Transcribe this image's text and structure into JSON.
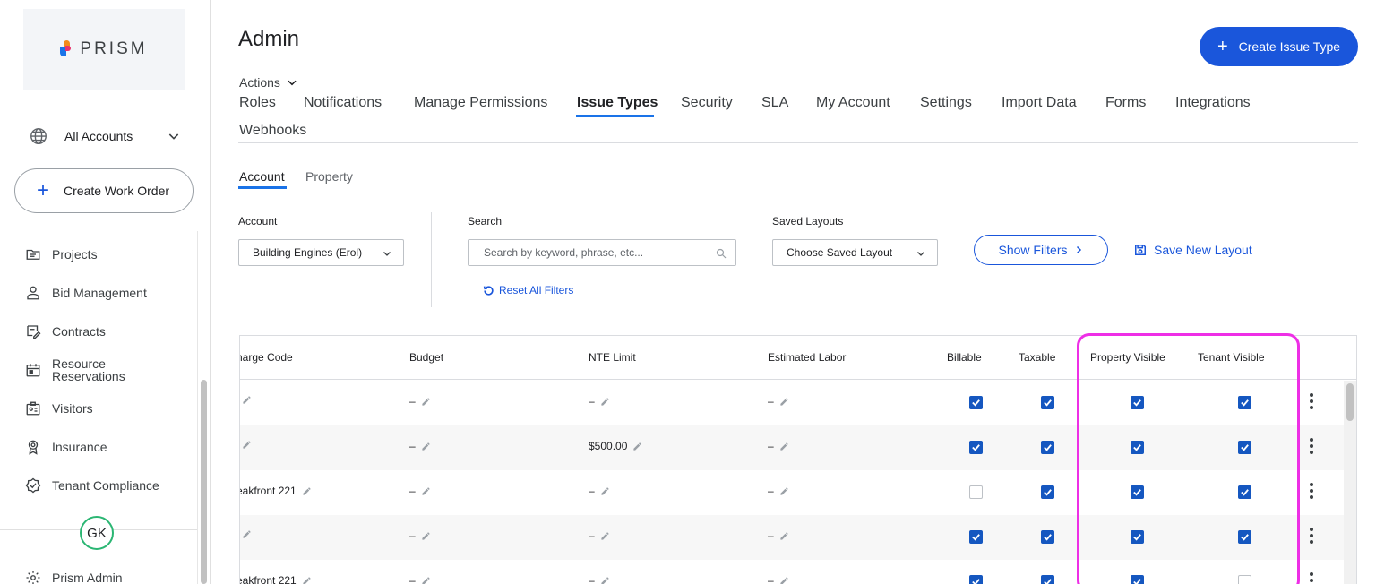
{
  "sidebar": {
    "logo_text": "PRISM",
    "account_selector": "All Accounts",
    "create_work_order": "Create Work Order",
    "items": [
      {
        "label": "Projects",
        "icon": "folder-icon"
      },
      {
        "label": "Bid Management",
        "icon": "person-icon"
      },
      {
        "label": "Contracts",
        "icon": "contract-icon"
      },
      {
        "label": "Resource\nReservations",
        "icon": "calendar-icon"
      },
      {
        "label": "Visitors",
        "icon": "visitor-badge-icon"
      },
      {
        "label": "Insurance",
        "icon": "award-icon"
      },
      {
        "label": "Tenant Compliance",
        "icon": "verified-icon"
      }
    ],
    "avatar_initials": "GK",
    "admin_item": "Prism Admin"
  },
  "header": {
    "title": "Admin",
    "create_button": "Create Issue Type",
    "actions_label": "Actions"
  },
  "tabs": [
    {
      "label": "Roles",
      "active": false
    },
    {
      "label": "Notifications",
      "active": false
    },
    {
      "label": "Manage Permissions",
      "active": false
    },
    {
      "label": "Issue Types",
      "active": true
    },
    {
      "label": "Security",
      "active": false
    },
    {
      "label": "SLA",
      "active": false
    },
    {
      "label": "My Account",
      "active": false
    },
    {
      "label": "Settings",
      "active": false
    },
    {
      "label": "Import Data",
      "active": false
    },
    {
      "label": "Forms",
      "active": false
    },
    {
      "label": "Integrations",
      "active": false
    },
    {
      "label": "Webhooks",
      "active": false
    }
  ],
  "subtabs": [
    {
      "label": "Account",
      "active": true
    },
    {
      "label": "Property",
      "active": false
    }
  ],
  "filters": {
    "account_label": "Account",
    "account_value": "Building Engines (Erol)",
    "search_label": "Search",
    "search_placeholder": "Search by keyword, phrase, etc...",
    "search_value": "",
    "layouts_label": "Saved Layouts",
    "layouts_value": "Choose Saved Layout",
    "reset_label": "Reset All Filters",
    "show_filters": "Show Filters",
    "save_layout": "Save New Layout"
  },
  "table": {
    "columns": [
      "harge Code",
      "Budget",
      "NTE Limit",
      "Estimated Labor",
      "Billable",
      "Taxable",
      "Property Visible",
      "Tenant Visible"
    ],
    "rows": [
      {
        "charge_code": "",
        "budget": "–",
        "nte": "–",
        "labor": "–",
        "billable": true,
        "taxable": true,
        "property_visible": true,
        "tenant_visible": true
      },
      {
        "charge_code": "",
        "budget": "–",
        "nte": "$500.00",
        "labor": "–",
        "billable": true,
        "taxable": true,
        "property_visible": true,
        "tenant_visible": true
      },
      {
        "charge_code": "eakfront 221",
        "budget": "–",
        "nte": "–",
        "labor": "–",
        "billable": false,
        "taxable": true,
        "property_visible": true,
        "tenant_visible": true
      },
      {
        "charge_code": "",
        "budget": "–",
        "nte": "–",
        "labor": "–",
        "billable": true,
        "taxable": true,
        "property_visible": true,
        "tenant_visible": true
      },
      {
        "charge_code": "eakfront 221",
        "budget": "–",
        "nte": "–",
        "labor": "–",
        "billable": true,
        "taxable": true,
        "property_visible": true,
        "tenant_visible": false
      }
    ]
  },
  "colors": {
    "accent": "#1a56db",
    "checkbox": "#1557c0",
    "highlight": "#ee2fe6",
    "avatar_ring": "#2bb673"
  }
}
